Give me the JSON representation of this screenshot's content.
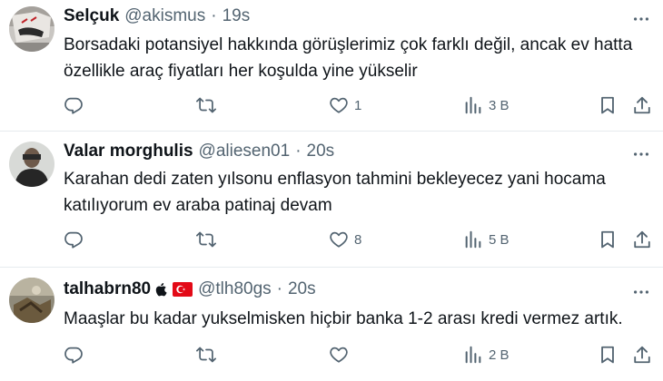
{
  "tweets": [
    {
      "name": "Selçuk",
      "handle": "@akismus",
      "sep": "·",
      "time": "19s",
      "text": "Borsadaki potansiyel hakkında görüşlerimiz çok farklı değil, ancak ev hatta özellikle araç fiyatları her koşulda yine yükselir",
      "likes": "1",
      "views": "3 B",
      "replies": "",
      "retweets": ""
    },
    {
      "name": "Valar morghulis",
      "handle": "@aliesen01",
      "sep": "·",
      "time": "20s",
      "text": "Karahan dedi zaten yılsonu enflasyon tahmini bekleyecez yani hocama katılıyorum ev araba patinaj devam",
      "likes": "8",
      "views": "5 B",
      "replies": "",
      "retweets": ""
    },
    {
      "name": "talhabrn80",
      "handle": "@tlh80gs",
      "sep": "·",
      "time": "20s",
      "text": "Maaşlar bu kadar yukselmisken hiçbir banka 1-2 arası kredi vermez artık.",
      "likes": "",
      "views": "2 B",
      "replies": "",
      "retweets": "",
      "badges": [
        "apple-logo-icon",
        "turkey-flag-icon"
      ]
    }
  ],
  "colors": {
    "text": "#0f1419",
    "secondary": "#536471",
    "divider": "#e6ebee",
    "flag_red": "#e30a17"
  },
  "icons": [
    "reply-icon",
    "retweet-icon",
    "heart-icon",
    "views-icon",
    "bookmark-icon",
    "share-icon",
    "more-icon"
  ]
}
